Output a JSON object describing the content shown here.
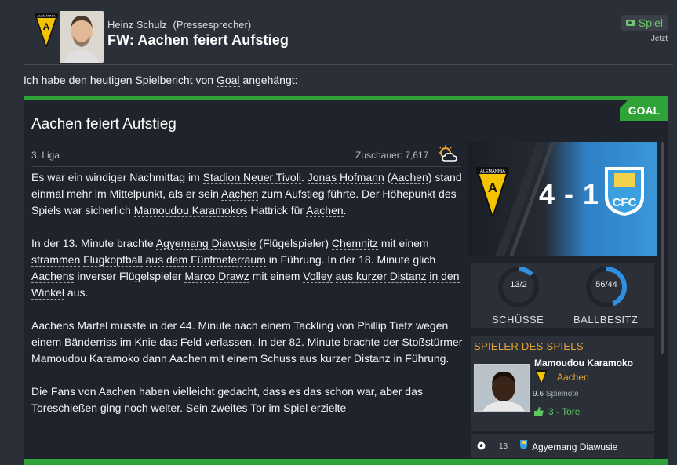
{
  "header": {
    "sender_name": "Heinz Schulz",
    "sender_role": "(Pressesprecher)",
    "subject": "FW: Aachen feiert Aufstieg",
    "tag_label": "Spiel",
    "time": "Jetzt"
  },
  "intro": {
    "prefix": "Ich habe den heutigen Spielbericht von ",
    "source": "Goal",
    "suffix": " angehängt:"
  },
  "article": {
    "tag": "GOAL",
    "title": "Aachen feiert Aufstieg",
    "league": "3. Liga",
    "attendance": "Zuschauer: 7,617",
    "weather_icon": "partly-cloudy-icon"
  },
  "match": {
    "score": "4 - 1",
    "home_badge": "alemannia-aachen-badge",
    "home_badge_text": "ALEMANNIA",
    "away_badge": "chemnitzer-fc-badge",
    "away_badge_text": "CFC"
  },
  "stats": {
    "shots": {
      "value": "13/2",
      "label": "SCHÜSSE",
      "home_share": 0.87
    },
    "possession": {
      "value": "56/44",
      "label": "BALLBESITZ",
      "home_share": 0.56
    },
    "colors": {
      "home": "#1f232b",
      "away": "#2f8fe0"
    }
  },
  "potm": {
    "title": "SPIELER DES SPIELS",
    "name": "Mamoudou Karamoko",
    "club": "Aachen",
    "rating": "9.6",
    "rating_label": "Spielnote",
    "goals": "3 - Tore"
  },
  "event": {
    "minute": "13",
    "player": "Agyemang Diawusie",
    "icon": "ball-icon"
  },
  "colors": {
    "accent": "#2fa337",
    "gold": "#e6a532",
    "positive": "#5ec85e"
  }
}
